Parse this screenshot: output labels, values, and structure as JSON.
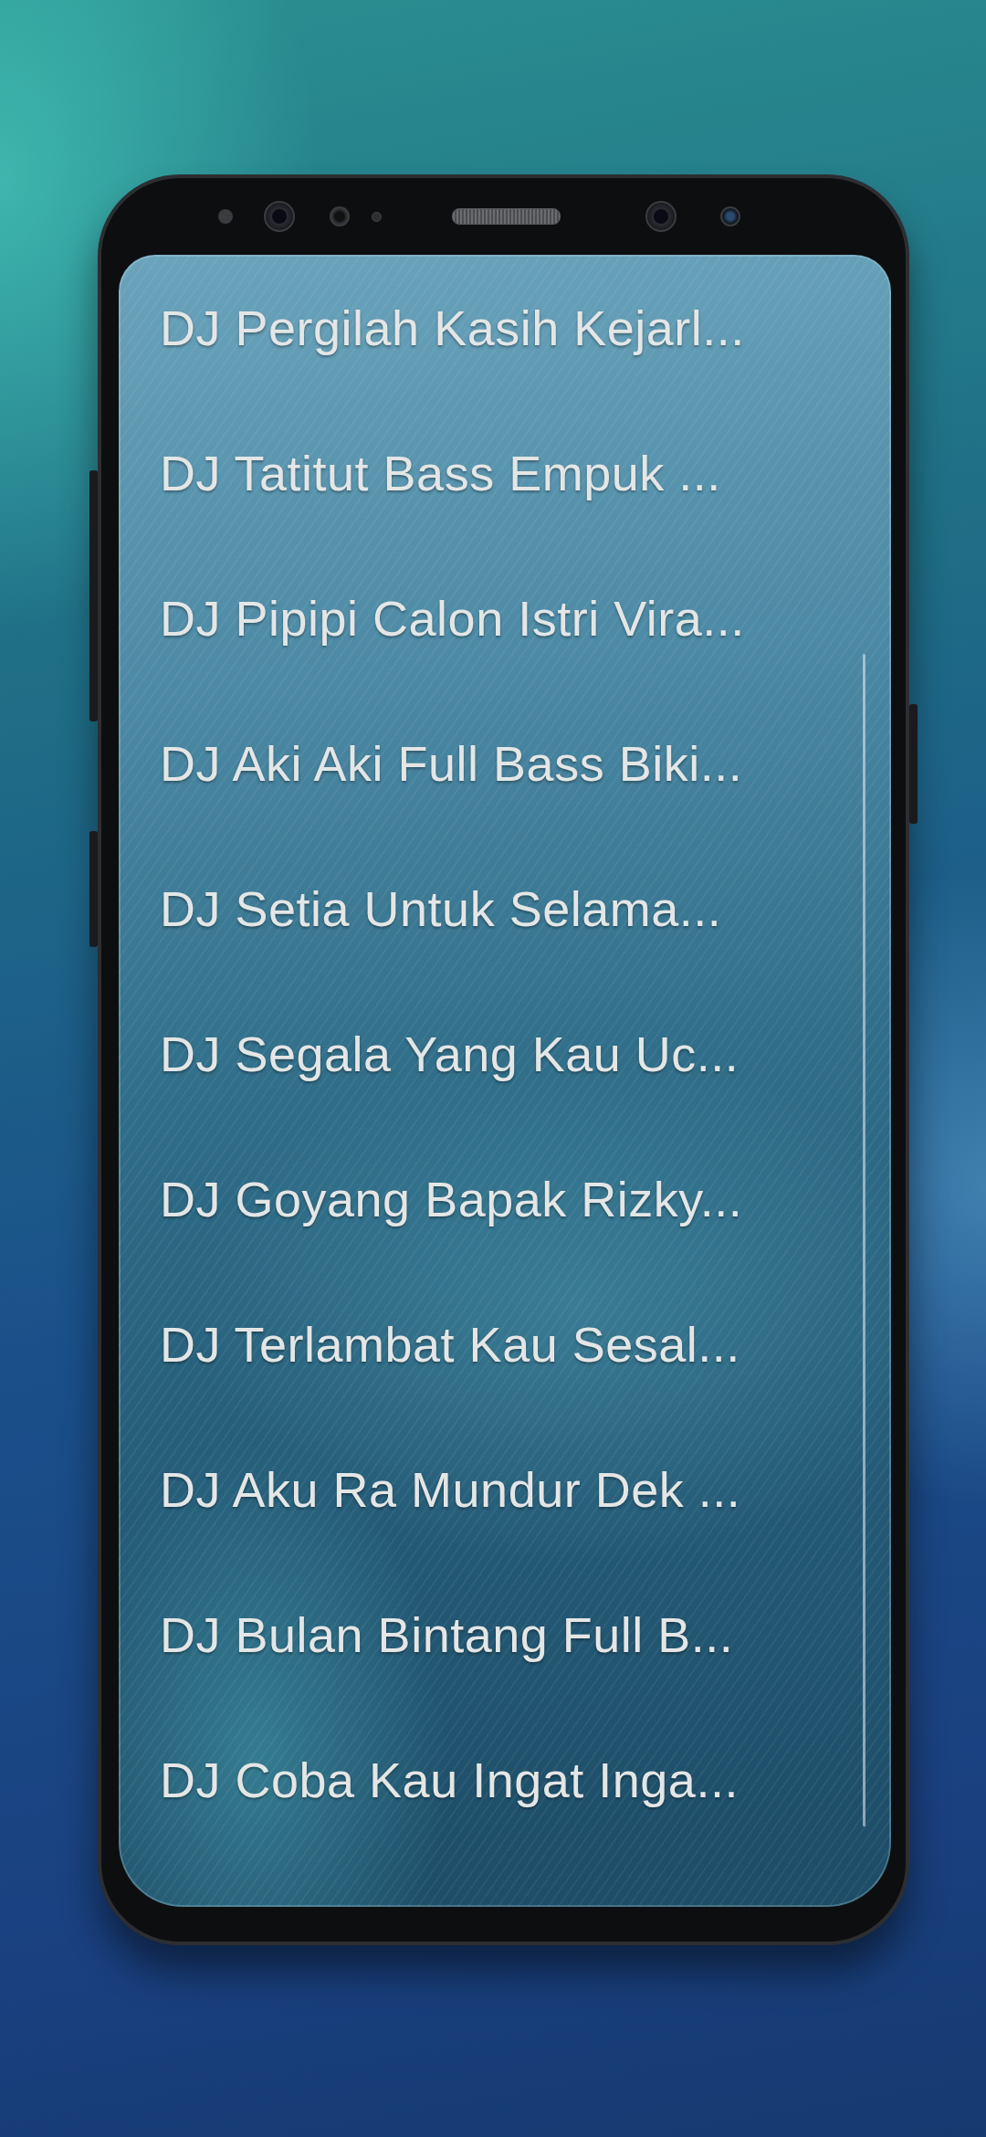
{
  "song_list": [
    {
      "title": "DJ Pergilah Kasih Kejarl..."
    },
    {
      "title": "DJ Tatitut Bass Empuk ..."
    },
    {
      "title": "DJ Pipipi Calon Istri Vira..."
    },
    {
      "title": "DJ Aki Aki Full Bass Biki..."
    },
    {
      "title": "DJ Setia Untuk Selama..."
    },
    {
      "title": "DJ Segala Yang Kau Uc..."
    },
    {
      "title": "DJ Goyang Bapak Rizky..."
    },
    {
      "title": "DJ Terlambat Kau Sesal..."
    },
    {
      "title": "DJ Aku Ra Mundur Dek ..."
    },
    {
      "title": "DJ Bulan Bintang Full B..."
    },
    {
      "title": "DJ Coba Kau Ingat Inga..."
    }
  ]
}
